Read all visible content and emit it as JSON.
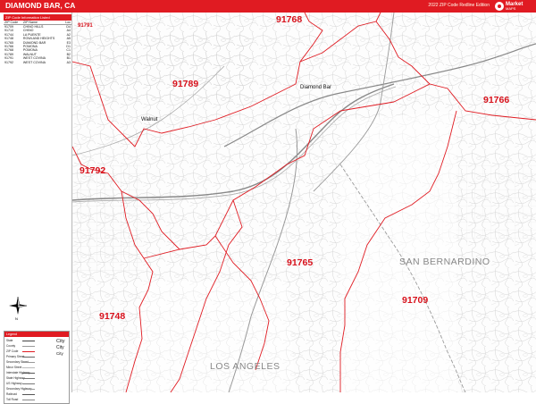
{
  "header": {
    "title": "DIAMOND BAR, CA",
    "edition": "2022 ZIP Code Redline Edition",
    "brand_word": "Market",
    "brand_word2": "MAPS"
  },
  "legend_top": {
    "caption": "ZIP Code Information Listed",
    "columns": [
      "ZIP Code",
      "ZIP Name",
      "Loc"
    ],
    "rows": [
      [
        "91709",
        "CHINO HILLS",
        "D4"
      ],
      [
        "91710",
        "CHINO",
        "A4"
      ],
      [
        "91744",
        "LA PUENTE",
        "A2"
      ],
      [
        "91748",
        "ROWLAND HEIGHTS",
        "A5"
      ],
      [
        "91765",
        "DIAMOND BAR",
        "E3"
      ],
      [
        "91766",
        "POMONA",
        "D1"
      ],
      [
        "91768",
        "POMONA",
        "C1"
      ],
      [
        "91789",
        "WALNUT",
        "B2"
      ],
      [
        "91791",
        "WEST COVINA",
        "B1"
      ],
      [
        "91792",
        "WEST COVINA",
        "A3"
      ]
    ]
  },
  "compass_label": "N",
  "legend_box": {
    "caption": "Legend",
    "items": [
      {
        "label": "State",
        "color": "#444"
      },
      {
        "label": "County",
        "color": "#999"
      },
      {
        "label": "ZIP Code",
        "color": "#e01b22"
      },
      {
        "label": "Primary Street",
        "color": "#666"
      },
      {
        "label": "Secondary Street",
        "color": "#999"
      },
      {
        "label": "Minor Street",
        "color": "#bbb"
      },
      {
        "label": "Interstate Highway",
        "color": "#555"
      },
      {
        "label": "State Highway",
        "color": "#777"
      },
      {
        "label": "US Highway",
        "color": "#777"
      },
      {
        "label": "Secondary Highway",
        "color": "#999"
      },
      {
        "label": "Railroad",
        "color": "#555"
      },
      {
        "label": "Toll Road",
        "color": "#888"
      }
    ],
    "cities": [
      "City",
      "City",
      "City"
    ]
  },
  "map": {
    "zip_labels": [
      "91768",
      "91791",
      "91789",
      "91766",
      "91792",
      "91765",
      "91709",
      "91748"
    ],
    "city_labels": [
      "Diamond Bar",
      "Walnut"
    ],
    "county_labels": [
      "SAN BERNARDINO",
      "LOS ANGELES"
    ]
  }
}
